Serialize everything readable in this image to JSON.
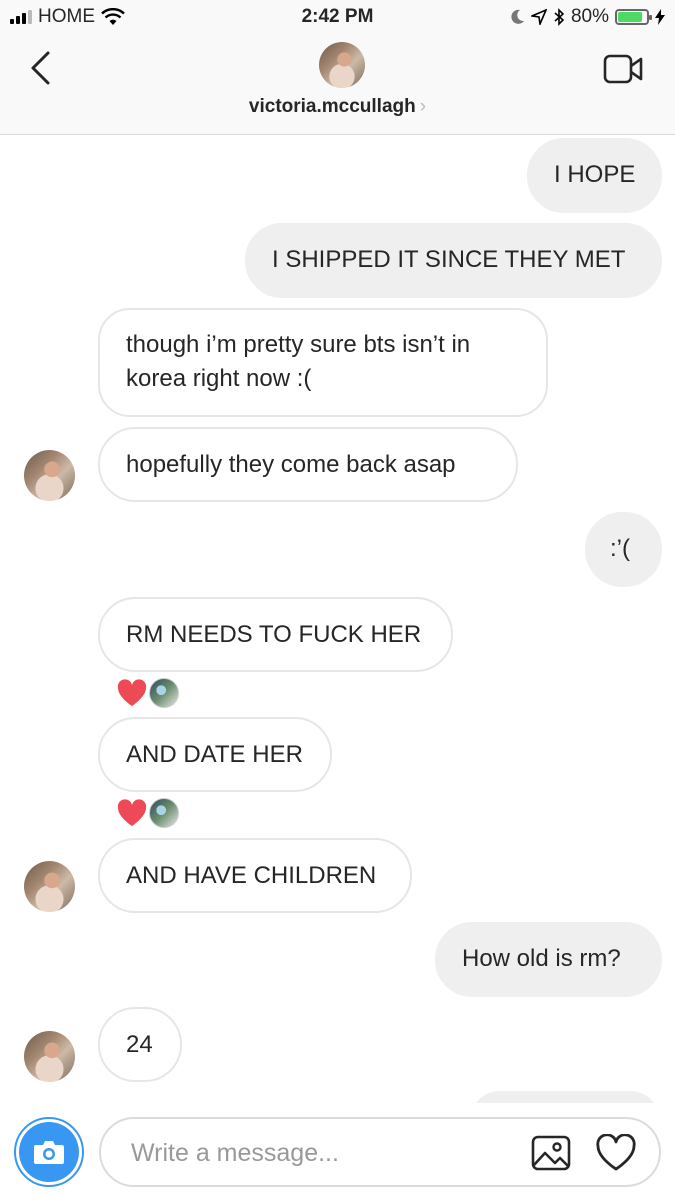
{
  "status_bar": {
    "carrier": "HOME",
    "time": "2:42 PM",
    "battery": "80%",
    "battery_level": 0.8
  },
  "header": {
    "username": "victoria.mccullagh",
    "chevron": "›",
    "back_icon": "chevron-left-icon",
    "video_icon": "video-call-icon"
  },
  "messages": [
    {
      "side": "out",
      "text": "I HOPE"
    },
    {
      "side": "out",
      "text": "I SHIPPED IT SINCE THEY MET"
    },
    {
      "side": "in",
      "line1": "though i’m pretty sure bts isn’t in",
      "line2": "korea right now :("
    },
    {
      "side": "in",
      "text": "hopefully they come back asap"
    },
    {
      "side": "out",
      "text": ":’("
    },
    {
      "side": "in",
      "text": "RM NEEDS TO FUCK HER",
      "reaction": "heart"
    },
    {
      "side": "in",
      "text": "AND DATE HER",
      "reaction": "heart"
    },
    {
      "side": "in",
      "text": "AND HAVE CHILDREN"
    },
    {
      "side": "out",
      "text": "How old is rm?"
    },
    {
      "side": "in",
      "text": "24"
    }
  ],
  "composer": {
    "placeholder": "Write a message...",
    "camera_icon": "camera-icon",
    "image_icon": "image-icon",
    "like_icon": "heart-icon"
  },
  "colors": {
    "accent": "#3897f0",
    "reaction_heart": "#ed4956",
    "outgoing_bubble": "#efefef",
    "incoming_border": "#e6e6e6"
  }
}
